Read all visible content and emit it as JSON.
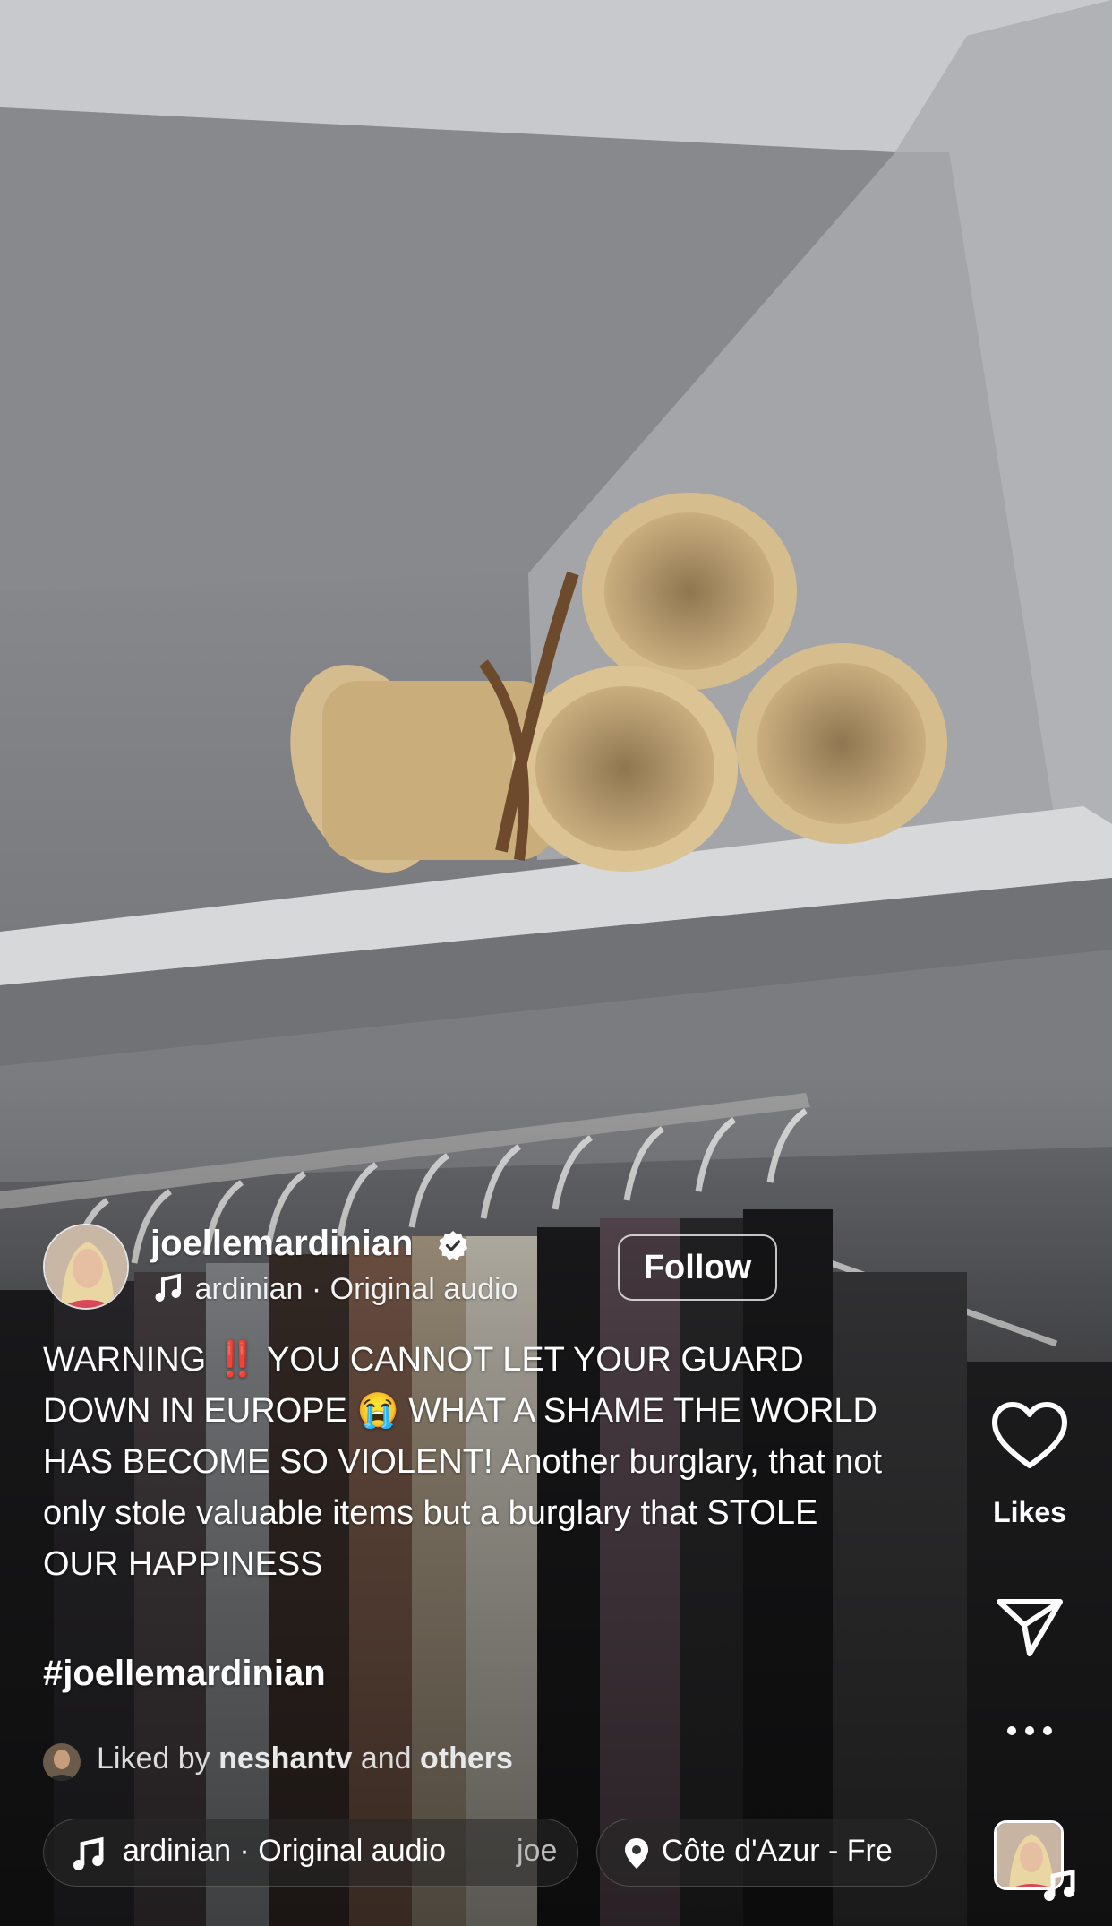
{
  "post": {
    "username": "joellemardinian",
    "verified": true,
    "audio_line": "ardinian · Original audio",
    "follow_label": "Follow",
    "caption": "WARNING ‼️ YOU CANNOT LET YOUR GUARD DOWN IN EUROPE 😭 WHAT A SHAME THE WORLD HAS BECOME SO VIOLENT! Another burglary, that not only stole valuable items but a burglary that STOLE OUR HAPPINESS",
    "hashtag": "#joellemardinian",
    "liked_by_prefix": "Liked by",
    "liked_by_user": "neshantv",
    "liked_by_and": "and",
    "liked_by_others": "others"
  },
  "bottom_pills": {
    "audio_text": "ardinian · Original audio",
    "audio_text_overflow": "joe",
    "location_text": "Côte d'Azur - Fre"
  },
  "rail": {
    "likes_label": "Likes",
    "icons": [
      "heart-icon",
      "share-icon",
      "more-icon",
      "audio-thumbnail"
    ]
  },
  "colors": {
    "text": "#ffffff",
    "muted_text": "#dcdcdc",
    "pill_bg": "rgba(40,40,40,0.55)"
  }
}
